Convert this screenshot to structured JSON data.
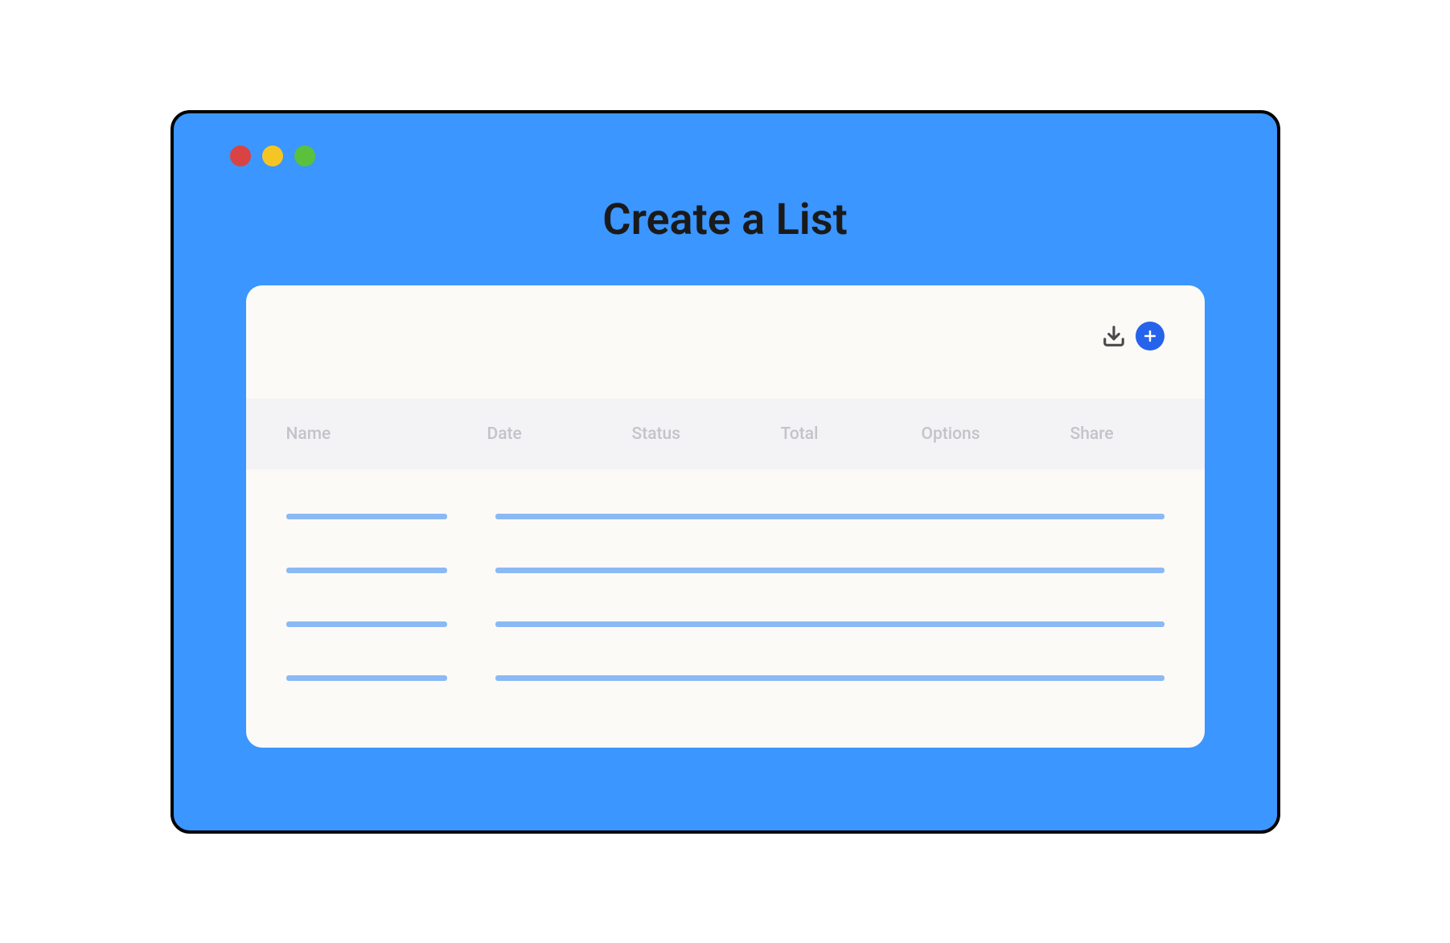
{
  "title": "Create a List",
  "window": {
    "traffic_lights": [
      "red",
      "yellow",
      "green"
    ]
  },
  "toolbar": {
    "download_icon": "download-icon",
    "add_icon": "plus-icon"
  },
  "table": {
    "columns": {
      "name": "Name",
      "date": "Date",
      "status": "Status",
      "total": "Total",
      "options": "Options",
      "share": "Share"
    },
    "skeleton_rows": 4
  },
  "colors": {
    "accent": "#3B96FF",
    "primary_button": "#2563EB",
    "skeleton": "#8BB9F5",
    "header_bg": "#F3F2F4",
    "card_bg": "#FBFAF7"
  }
}
